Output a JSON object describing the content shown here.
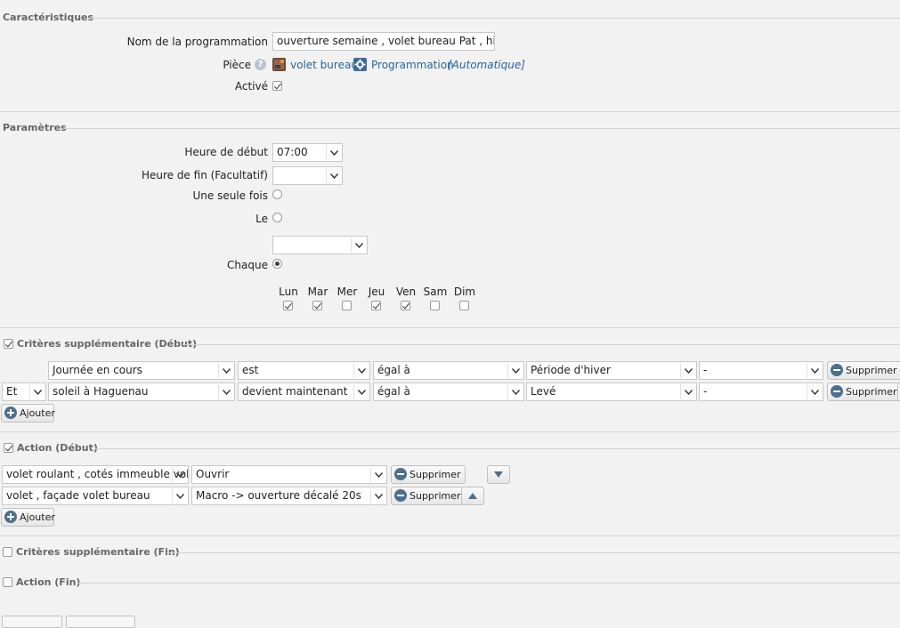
{
  "characteristics": {
    "legend": "Caractéristiques",
    "name_label": "Nom de la programmation",
    "name_value": "ouverture semaine , volet bureau Pat , hivert",
    "room_label": "Pièce",
    "room_value": "volet bureau",
    "programmation_link": "Programmation",
    "programmation_mode": "[Automatique]",
    "active_label": "Activé"
  },
  "parameters": {
    "legend": "Paramètres",
    "start_label": "Heure de début",
    "start_value": "07:00",
    "end_label": "Heure de fin (Facultatif)",
    "end_value": "",
    "once_label": "Une seule fois",
    "on_label": "Le",
    "every_label": "Chaque",
    "days": [
      "Lun",
      "Mar",
      "Mer",
      "Jeu",
      "Ven",
      "Sam",
      "Dim"
    ],
    "days_checked": [
      true,
      true,
      false,
      true,
      true,
      false,
      false
    ]
  },
  "criteria_start": {
    "legend": "Critères supplémentaire (Début)",
    "rows": [
      {
        "conj": "",
        "subject": "Journée en cours",
        "verb": "est",
        "op": "égal à",
        "value": "Période  d'hiver",
        "extra": "-",
        "delete": "Supprimer"
      },
      {
        "conj": "Et",
        "subject": "soleil à Haguenau",
        "verb": "devient maintenant",
        "op": "égal à",
        "value": "Levé",
        "extra": "-",
        "delete": "Supprimer"
      }
    ],
    "add": "Ajouter"
  },
  "action_start": {
    "legend": "Action (Début)",
    "rows": [
      {
        "device": "volet roulant , cotés immeuble vol",
        "action": "Ouvrir",
        "delete": "Supprimer"
      },
      {
        "device": "volet , façade volet bureau",
        "action": "Macro -> ouverture décalé 20s",
        "delete": "Supprimer"
      }
    ],
    "add": "Ajouter"
  },
  "criteria_end": {
    "legend": "Critères supplémentaire (Fin)"
  },
  "action_end": {
    "legend": "Action (Fin)"
  },
  "icons": {
    "help": "help-icon",
    "room": "room-icon",
    "programmation": "gear-icon",
    "delete": "minus-circle-icon",
    "add": "plus-circle-icon"
  }
}
